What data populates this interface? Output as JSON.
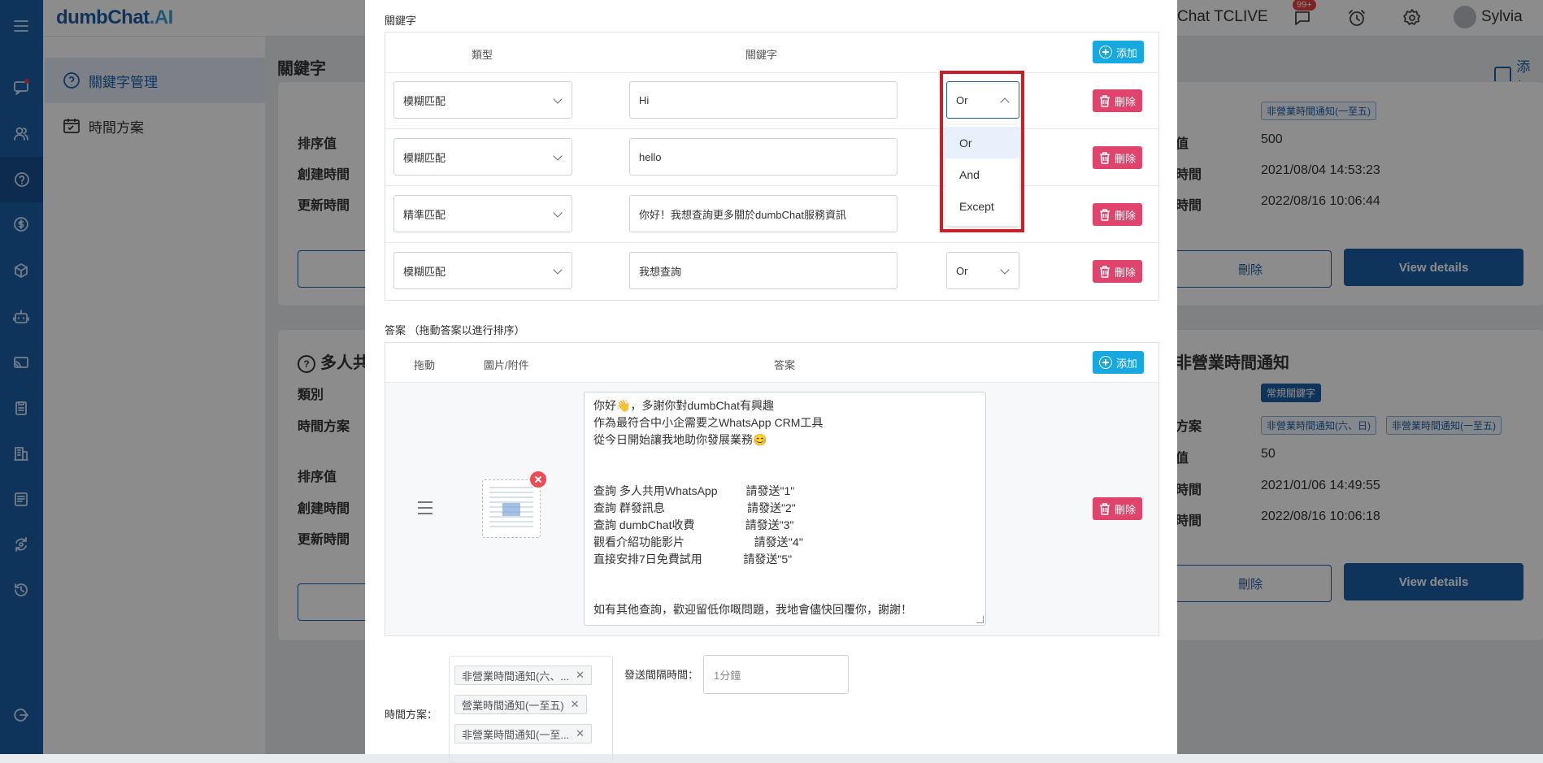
{
  "app": {
    "logo_main": "dumbChat",
    "logo_suffix": ".AI"
  },
  "topbar": {
    "account_text": "Chat TCLIVE",
    "notification_count": "99+",
    "user_name": "Sylvia"
  },
  "rail_icons": [
    "menu-icon",
    "chat-icon",
    "contacts-icon",
    "help-icon",
    "payment-icon",
    "package-icon",
    "robot-icon",
    "broadcast-icon",
    "clipboard-icon",
    "building-icon",
    "report-icon",
    "sync-icon",
    "history-icon",
    "logout-icon"
  ],
  "sidebar": {
    "items": [
      {
        "label": "關鍵字管理",
        "active": true
      },
      {
        "label": "時間方案",
        "active": false
      }
    ]
  },
  "background": {
    "page_title": "關鍵字",
    "add_label": "添加",
    "card1": {
      "rows_left": [
        "排序值",
        "創建時間",
        "更新時間"
      ],
      "tags": [
        "非營業時間通知(一至五)"
      ],
      "values": [
        {
          "label": "值",
          "value": "500"
        },
        {
          "label": "時間",
          "value": "2021/08/04 14:53:23"
        },
        {
          "label": "時間",
          "value": "2022/08/16 10:06:44"
        }
      ],
      "delete_label": "刪除",
      "view_label": "View details"
    },
    "card2": {
      "title_left": "多人共",
      "title_right": "非營業時間通知",
      "rows_left": [
        "類別",
        "時間方案",
        "排序值",
        "創建時間",
        "更新時間"
      ],
      "category_tag": "常規關鍵字",
      "plan_label": "方案",
      "plan_tags": [
        "非營業時間通知(六、日)",
        "非營業時間通知(一至五)"
      ],
      "values": [
        {
          "label": "值",
          "value": "50"
        },
        {
          "label": "時間",
          "value": "2021/01/06 14:49:55"
        },
        {
          "label": "時間",
          "value": "2022/08/16 10:06:18"
        }
      ],
      "delete_label": "刪除",
      "view_label": "View details"
    }
  },
  "modal": {
    "keyword_section_label": "關鍵字",
    "keyword_table": {
      "headers": {
        "type": "類型",
        "keyword": "關鍵字"
      },
      "add_label": "添加",
      "delete_label": "刪除",
      "rows": [
        {
          "type": "模糊匹配",
          "keyword": "Hi",
          "logic": "Or"
        },
        {
          "type": "模糊匹配",
          "keyword": "hello"
        },
        {
          "type": "精準匹配",
          "keyword": "你好！我想查詢更多關於dumbChat服務資訊"
        },
        {
          "type": "模糊匹配",
          "keyword": "我想查詢",
          "logic": "Or"
        }
      ]
    },
    "logic_dropdown": {
      "options": [
        "Or",
        "And",
        "Except"
      ],
      "selected": "Or"
    },
    "answer_section_label": "答案 （拖動答案以進行排序）",
    "answer_table": {
      "headers": {
        "drag": "拖動",
        "attachment": "圖片/附件",
        "answer": "答案"
      },
      "add_label": "添加",
      "delete_label": "刪除",
      "answer_lines": [
        "你好👋，多謝你對dumbChat有興趣",
        "作為最符合中小企需要之WhatsApp CRM工具",
        "從今日開始讓我地助你發展業務😊",
        "",
        "",
        "查詢 多人共用WhatsApp         請發送\"1\"",
        "查詢 群發訊息                          請發送\"2\"",
        "查詢 dumbChat收費                請發送\"3\"",
        "觀看介紹功能影片                      請發送''4''",
        "直接安排7日免費試用             請發送\"5\"",
        "",
        "",
        "如有其他查詢，歡迎留低你嘅問題，我地會儘快回覆你，謝謝！"
      ]
    },
    "time_plan_label": "時間方案：",
    "time_plan_tags": [
      "非營業時間通知(六、...",
      "營業時間通知(一至五)",
      "非營業時間通知(一至..."
    ],
    "interval_label": "發送間隔時間：",
    "interval_placeholder": "1分鐘"
  },
  "colors": {
    "brand": "#1d5fa8",
    "add_button": "#16a8e0",
    "delete_button": "#e0436b",
    "highlight_frame": "#c8202a"
  }
}
